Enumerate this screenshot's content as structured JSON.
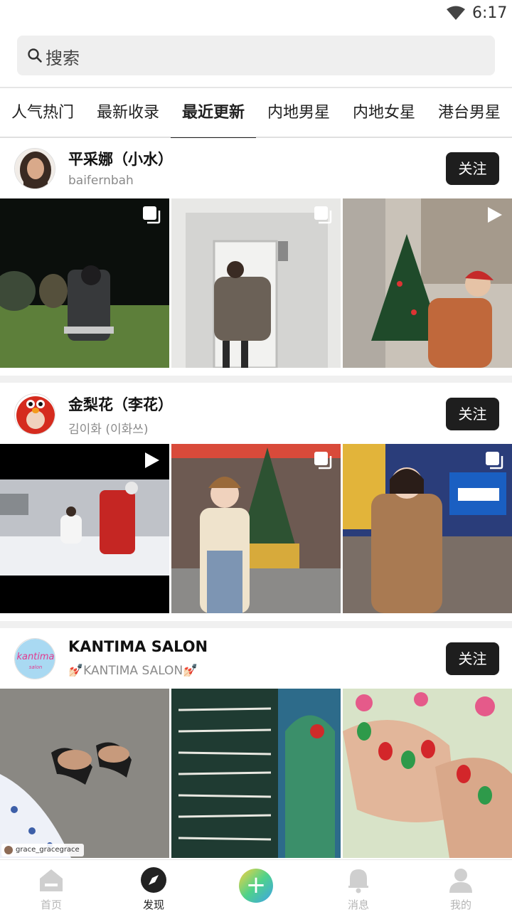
{
  "status_bar": {
    "time": "6:17"
  },
  "search": {
    "placeholder": "搜索"
  },
  "tabs": [
    {
      "label": "人气热门"
    },
    {
      "label": "最新收录"
    },
    {
      "label": "最近更新"
    },
    {
      "label": "内地男星"
    },
    {
      "label": "内地女星"
    },
    {
      "label": "港台男星"
    }
  ],
  "active_tab": "最近更新",
  "feed": [
    {
      "name": "平采娜（小水）",
      "handle": "baifernbah",
      "follow_label": "关注",
      "photos": [
        {
          "badge": "multi"
        },
        {
          "badge": "multi"
        },
        {
          "badge": "video"
        }
      ]
    },
    {
      "name": "金梨花（李花）",
      "handle": "김이화 (이화쓰)",
      "follow_label": "关注",
      "photos": [
        {
          "badge": "video"
        },
        {
          "badge": "multi"
        },
        {
          "badge": "multi"
        }
      ]
    },
    {
      "name": "KANTIMA SALON",
      "handle": "💅🏻KANTIMA SALON💅🏻",
      "follow_label": "关注",
      "avatar_text": "kantima",
      "photos": [
        {
          "badge": "none",
          "watermark": "grace_gracegrace"
        },
        {
          "badge": "none"
        },
        {
          "badge": "none"
        }
      ]
    }
  ],
  "bottom_nav": [
    {
      "label": "首页",
      "icon": "home-icon"
    },
    {
      "label": "发现",
      "icon": "compass-icon"
    },
    {
      "label": "",
      "icon": "plus-icon"
    },
    {
      "label": "消息",
      "icon": "bell-icon"
    },
    {
      "label": "我的",
      "icon": "person-icon"
    }
  ],
  "colors": {
    "follow_button": "#1e1e1e",
    "active_text": "#222222",
    "inactive_nav": "#b5b5b5"
  }
}
